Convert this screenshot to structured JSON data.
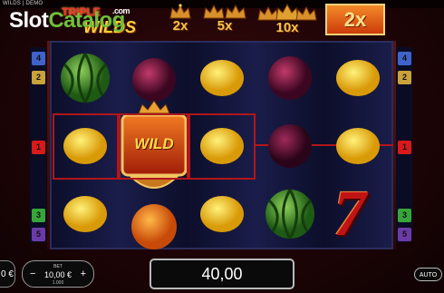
{
  "top_bar": {
    "game_label": "WILDS | DEMO"
  },
  "watermark": {
    "slot": "Slot",
    "catalog": "Catalog",
    "domain": ".com"
  },
  "game_title": {
    "line1": "TRIPLE",
    "line2": "WILDS"
  },
  "multipliers": [
    "2x",
    "5x",
    "10x"
  ],
  "active_multiplier": "2x",
  "reels": [
    [
      "watermelon",
      "lemon",
      "lemon",
      "lemon"
    ],
    [
      "plum",
      "wild",
      "orange"
    ],
    [
      "lemon",
      "lemon",
      "lemon"
    ],
    [
      "plum",
      "plum",
      "watermelon"
    ],
    [
      "lemon",
      "lemon",
      "seven"
    ]
  ],
  "wild_label": "WILD",
  "seven_label": "7",
  "left_lines": [
    "4",
    "2",
    "1",
    "3",
    "5"
  ],
  "right_lines": [
    "4",
    "2",
    "1",
    "3",
    "5"
  ],
  "line_colors": {
    "4": "#3f63c9",
    "2": "#c9a33a",
    "1": "#d81a1a",
    "3": "#37a53a",
    "5": "#6b3aa8"
  },
  "footer": {
    "left_partial": "0 €",
    "bet_label": "BET",
    "bet_value": "10,00 €",
    "bet_sub": "1.000",
    "minus": "−",
    "plus": "+",
    "win_value": "40,00",
    "auto_label": "AUTO"
  }
}
